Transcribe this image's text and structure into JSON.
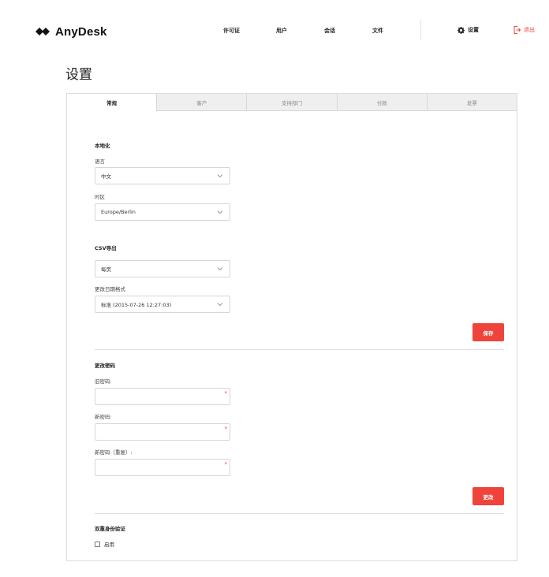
{
  "brand": {
    "name": "AnyDesk"
  },
  "nav": {
    "items": [
      {
        "key": "license",
        "label": "许可证"
      },
      {
        "key": "users",
        "label": "用户"
      },
      {
        "key": "sessions",
        "label": "会话"
      },
      {
        "key": "files",
        "label": "文件"
      }
    ],
    "settings_label": "设置",
    "logout_label": "退出"
  },
  "page": {
    "title": "设置"
  },
  "tabs": [
    {
      "label": "常规",
      "active": true
    },
    {
      "label": "客户",
      "active": false
    },
    {
      "label": "支持部门",
      "active": false
    },
    {
      "label": "付款",
      "active": false
    },
    {
      "label": "发票",
      "active": false
    }
  ],
  "localization": {
    "title": "本地化",
    "language_label": "语言",
    "language_value": "中文",
    "timezone_label": "时区",
    "timezone_value": "Europe/Berlin"
  },
  "csv": {
    "title": "CSV导出",
    "delimiter_value": "每页",
    "date_format_label": "更改日期格式",
    "date_format_value": "标准 (2015-07-26 12:27:03)",
    "save_label": "保存"
  },
  "password": {
    "title": "更改密码",
    "old_label": "旧密码:",
    "new_label": "新密码:",
    "repeat_label": "新密码（重复）:",
    "required_mark": "*",
    "change_label": "更改"
  },
  "twofa": {
    "title": "双重身份验证",
    "enable_label": "启用",
    "enabled": false
  },
  "colors": {
    "accent": "#ef443b",
    "tab_inactive": "#efefef",
    "border": "#dcdcdc"
  }
}
